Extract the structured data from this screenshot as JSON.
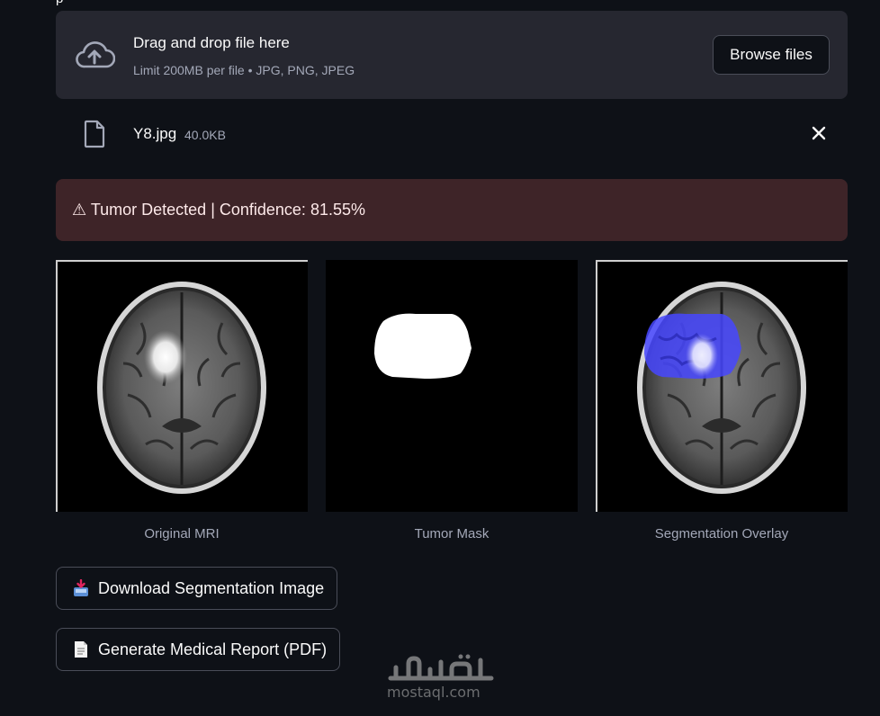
{
  "uploader": {
    "title": "Drag and drop file here",
    "limit": "Limit 200MB per file • JPG, PNG, JPEG",
    "browse_label": "Browse files",
    "icon": "cloud-upload-icon"
  },
  "file": {
    "name": "Y8.jpg",
    "size": "40.0KB",
    "icon": "file-icon",
    "remove_icon": "close-icon"
  },
  "alert": {
    "text": "⚠ Tumor Detected | Confidence: 81.55%",
    "color": "#3e2428"
  },
  "images": [
    {
      "caption": "Original MRI"
    },
    {
      "caption": "Tumor Mask"
    },
    {
      "caption": "Segmentation Overlay"
    }
  ],
  "actions": {
    "download_label": "Download Segmentation Image",
    "download_icon": "inbox-tray-icon",
    "report_label": "Generate Medical Report (PDF)",
    "report_icon": "document-icon"
  },
  "watermark": {
    "logo_text": "مستقل",
    "site": "mostaql.com"
  },
  "colors": {
    "background": "#0e1117",
    "panel": "#262730",
    "overlay": "#4646ff"
  }
}
